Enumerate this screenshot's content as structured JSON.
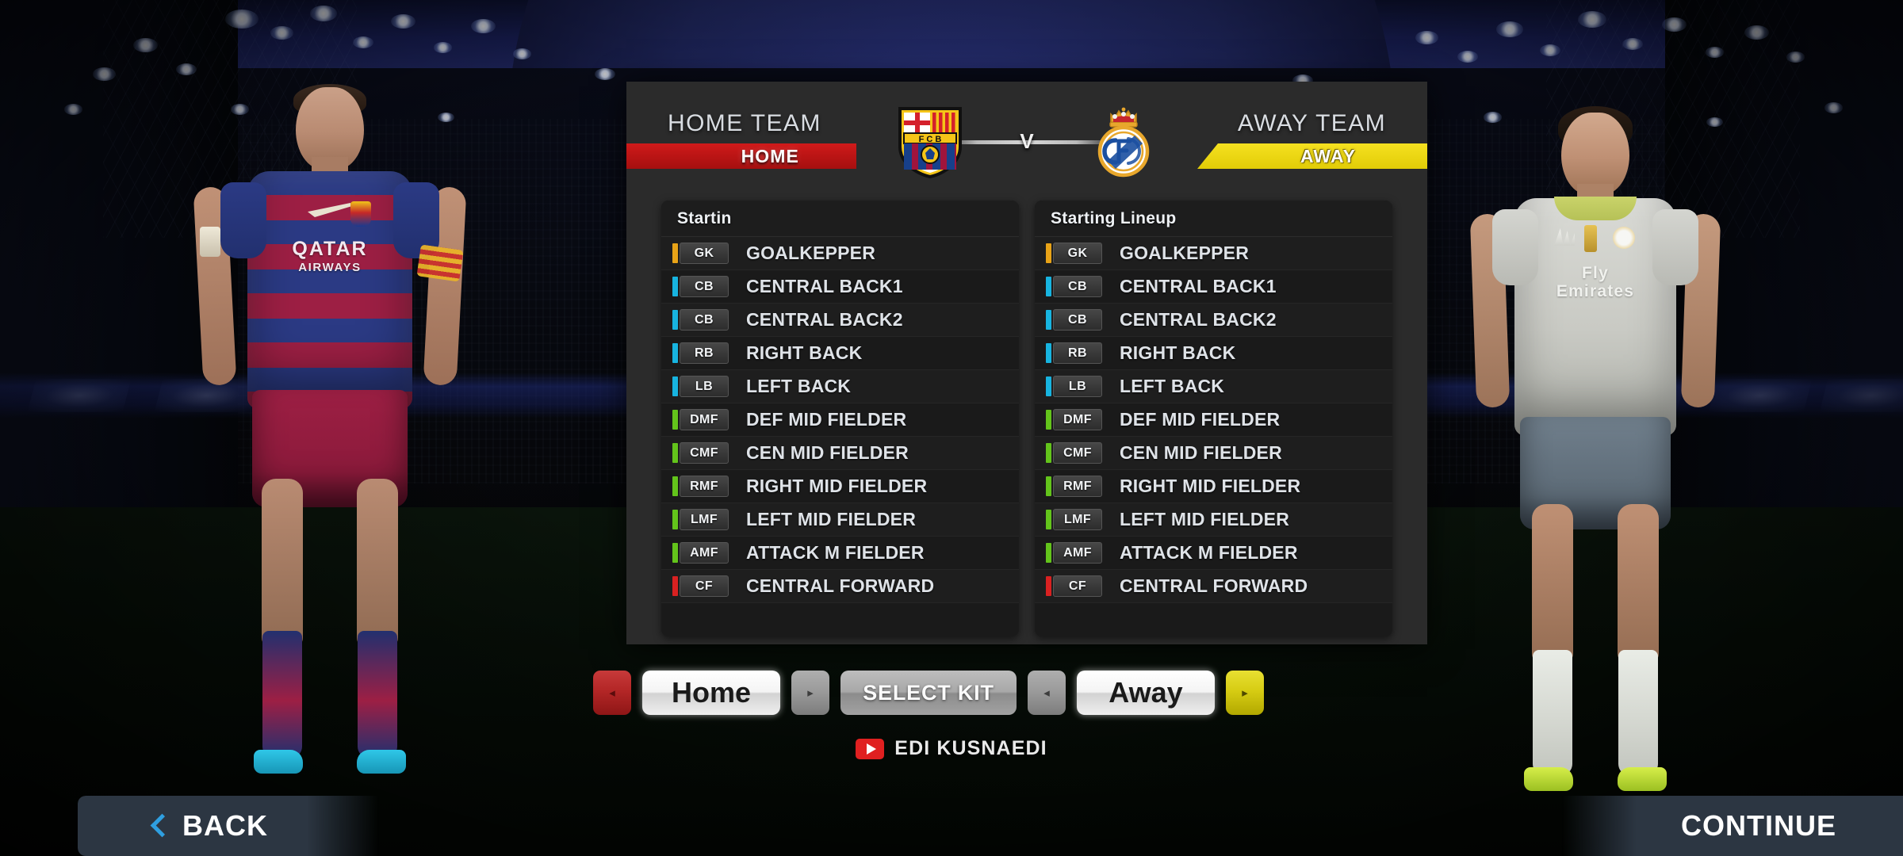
{
  "dialog": {
    "home_team_label": "HOME TEAM",
    "away_team_label": "AWAY TEAM",
    "home_banner": "HOME",
    "away_banner": "AWAY",
    "vs": "V",
    "home_crest_name": "fc-barcelona-crest",
    "away_crest_name": "real-madrid-crest",
    "home_crest_text": "F C B"
  },
  "home_panel": {
    "header": "Startin",
    "rows": [
      {
        "pos": "GK",
        "name": "GOALKEPPER",
        "color": "#e8a317"
      },
      {
        "pos": "CB",
        "name": "CENTRAL BACK1",
        "color": "#17b4e0"
      },
      {
        "pos": "CB",
        "name": "CENTRAL BACK2",
        "color": "#17b4e0"
      },
      {
        "pos": "RB",
        "name": "RIGHT BACK",
        "color": "#17b4e0"
      },
      {
        "pos": "LB",
        "name": "LEFT BACK",
        "color": "#17b4e0"
      },
      {
        "pos": "DMF",
        "name": "DEF MID FIELDER",
        "color": "#63c41b"
      },
      {
        "pos": "CMF",
        "name": "CEN MID FIELDER",
        "color": "#63c41b"
      },
      {
        "pos": "RMF",
        "name": "RIGHT MID FIELDER",
        "color": "#63c41b"
      },
      {
        "pos": "LMF",
        "name": "LEFT MID FIELDER",
        "color": "#63c41b"
      },
      {
        "pos": "AMF",
        "name": "ATTACK M FIELDER",
        "color": "#63c41b"
      },
      {
        "pos": "CF",
        "name": "CENTRAL FORWARD",
        "color": "#d92121"
      }
    ]
  },
  "away_panel": {
    "header": "Starting Lineup",
    "rows": [
      {
        "pos": "GK",
        "name": "GOALKEPPER",
        "color": "#e8a317"
      },
      {
        "pos": "CB",
        "name": "CENTRAL BACK1",
        "color": "#17b4e0"
      },
      {
        "pos": "CB",
        "name": "CENTRAL BACK2",
        "color": "#17b4e0"
      },
      {
        "pos": "RB",
        "name": "RIGHT BACK",
        "color": "#17b4e0"
      },
      {
        "pos": "LB",
        "name": "LEFT BACK",
        "color": "#17b4e0"
      },
      {
        "pos": "DMF",
        "name": "DEF MID FIELDER",
        "color": "#63c41b"
      },
      {
        "pos": "CMF",
        "name": "CEN MID FIELDER",
        "color": "#63c41b"
      },
      {
        "pos": "RMF",
        "name": "RIGHT MID FIELDER",
        "color": "#63c41b"
      },
      {
        "pos": "LMF",
        "name": "LEFT MID FIELDER",
        "color": "#63c41b"
      },
      {
        "pos": "AMF",
        "name": "ATTACK M FIELDER",
        "color": "#63c41b"
      },
      {
        "pos": "CF",
        "name": "CENTRAL FORWARD",
        "color": "#d92121"
      }
    ]
  },
  "kitbar": {
    "home_prev": "◂",
    "home_kit": "Home",
    "home_next": "▸",
    "select_kit": "SELECT KIT",
    "away_prev": "◂",
    "away_kit": "Away",
    "away_next": "▸"
  },
  "watermark": {
    "text": "EDI KUSNAEDI",
    "icon": "youtube-play-icon"
  },
  "navbar": {
    "back": "BACK",
    "continue": "CONTINUE"
  },
  "players": {
    "home": {
      "sponsor": "QATAR",
      "sponsor_sub": "AIRWAYS"
    },
    "away": {
      "sponsor_line1": "Fly",
      "sponsor_line2": "Emirates"
    }
  },
  "colors": {
    "home_accent": "#b32626",
    "away_accent": "#e2cc07",
    "panel_bg": "#1a1a1a",
    "dialog_bg": "#2b2b2b",
    "nav_bg": "#2c3642",
    "chevron": "#2f9fe0"
  }
}
